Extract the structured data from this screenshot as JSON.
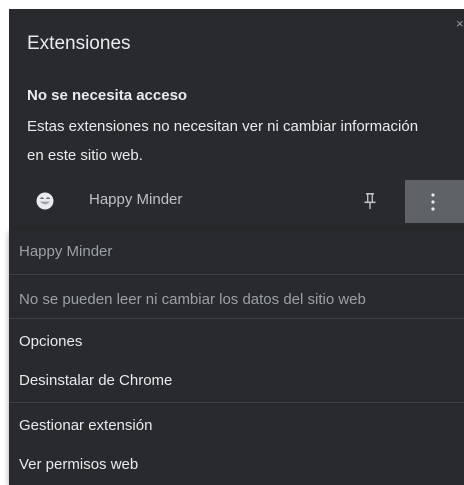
{
  "popup": {
    "title": "Extensiones",
    "close_glyph": "×",
    "section_heading": "No se necesita acceso",
    "section_description": "Estas extensiones no necesitan ver ni cambiar información en este sitio web."
  },
  "extension": {
    "name": "Happy Minder",
    "icon": "smiley-face-icon",
    "pin_icon": "pin-icon",
    "more_icon": "three-dot-menu-icon"
  },
  "menu": {
    "header": "Happy Minder",
    "site_access": "No se pueden leer ni cambiar los datos del sitio web",
    "options": "Opciones",
    "uninstall": "Desinstalar de Chrome",
    "manage": "Gestionar extensión",
    "permissions": "Ver permisos web"
  },
  "colors": {
    "panel_bg": "#292a2d",
    "text": "#e8eaed",
    "muted_text": "#9aa0a6",
    "hover_bg": "#5f6368"
  }
}
